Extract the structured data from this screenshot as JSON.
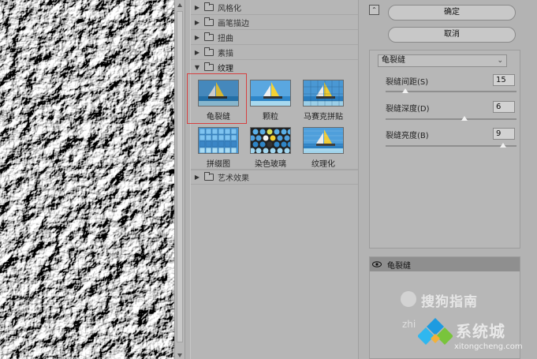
{
  "tree": {
    "categories_before": [
      {
        "label": "风格化",
        "open": false
      },
      {
        "label": "画笔描边",
        "open": false
      },
      {
        "label": "扭曲",
        "open": false
      },
      {
        "label": "素描",
        "open": false
      }
    ],
    "open_category": {
      "label": "纹理",
      "open": true
    },
    "thumbnails": [
      {
        "label": "龟裂缝",
        "selected": true
      },
      {
        "label": "颗粒",
        "selected": false
      },
      {
        "label": "马赛克拼贴",
        "selected": false
      },
      {
        "label": "拼缀图",
        "selected": false
      },
      {
        "label": "染色玻璃",
        "selected": false
      },
      {
        "label": "纹理化",
        "selected": false
      }
    ],
    "categories_after": [
      {
        "label": "艺术效果",
        "open": false
      }
    ]
  },
  "right_panel": {
    "ok_label": "确定",
    "cancel_label": "取消",
    "filter_select": "龟裂缝",
    "params": [
      {
        "label": "裂缝间距(S)",
        "value": "15",
        "fraction": 0.15
      },
      {
        "label": "裂缝深度(D)",
        "value": "6",
        "fraction": 0.6
      },
      {
        "label": "裂缝亮度(B)",
        "value": "9",
        "fraction": 0.9
      }
    ],
    "layer_name": "龟裂缝"
  },
  "watermark": {
    "brand": "搜狗指南",
    "site_prefix": "zhi",
    "site_name": "系统城",
    "url": "xitongcheng.com"
  },
  "icons": {
    "collapse": "double-chevron-up-icon",
    "eye": "eye-icon",
    "folder": "folder-icon",
    "expand": "triangle-right-icon",
    "collapse_tree": "triangle-down-icon",
    "dropdown": "chevron-down-icon"
  }
}
